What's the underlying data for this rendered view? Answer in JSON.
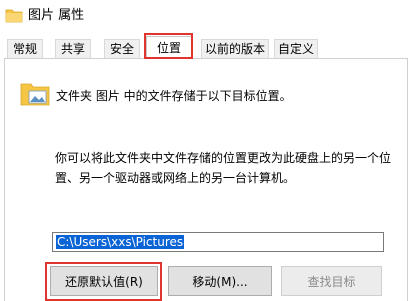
{
  "window": {
    "title": "图片 属性",
    "icon": "folder-icon"
  },
  "tabs": [
    {
      "label": "常规"
    },
    {
      "label": "共享"
    },
    {
      "label": "安全"
    },
    {
      "label": "位置",
      "active": true
    },
    {
      "label": "以前的版本"
    },
    {
      "label": "自定义"
    }
  ],
  "location": {
    "description_top": "文件夹 图片 中的文件存储于以下目标位置。",
    "description_bottom": "你可以将此文件夹中文件存储的位置更改为此硬盘上的另一个位置、另一个驱动器或网络上的另一台计算机。",
    "path_value": "C:\\Users\\xxs\\Pictures"
  },
  "buttons": {
    "restore_default": "还原默认值(R)",
    "move": "移动(M)...",
    "find_target": "查找目标"
  },
  "colors": {
    "highlight": "#e0342c",
    "selection": "#0a64d6",
    "folder": "#f5c543"
  }
}
